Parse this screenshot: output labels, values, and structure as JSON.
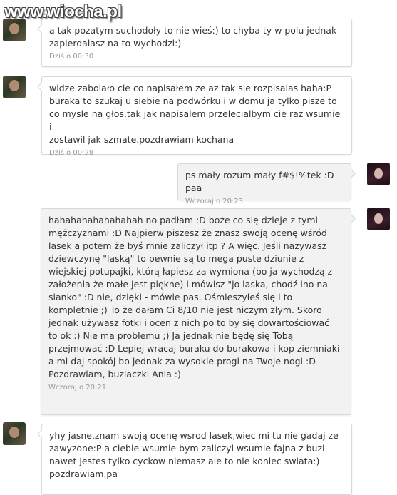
{
  "watermark": "www.wiocha.pl",
  "messages": [
    {
      "side": "left",
      "text": "a tak pozatym suchodoły to nie wieś:) to chyba ty w polu jednak\nzapierdalasz na to wychodzi:)",
      "time": "Dziś o 00:30"
    },
    {
      "side": "left",
      "text": "widze zabolało cie co napisałem ze az tak sie rozpisalas haha:P\nburaka to szukaj u siebie na podwórku i w domu ja tylko pisze to\nco mysle na głos,tak jak napisalem przelecialbym cie raz wsumie i\nzostawil jak szmate.pozdrawiam kochana",
      "time": "Dziś o 00:28"
    },
    {
      "side": "right",
      "text": "ps mały rozum mały f#$!%tek :D paa",
      "time": "Wczoraj o 20:23"
    },
    {
      "side": "right",
      "text": "hahahahahahahahah no padłam :D boże co się dzieje z tymi\nmężczyznami :D Najpierw piszesz że znasz swoją ocenę wśród\nlasek a potem że byś mnie zaliczył itp ? A więc. Jeśli nazywasz\ndziewczynę \"laską\" to pewnie są to mega puste dziunie z\nwiejskiej potupajki, którą łapiesz za wymiona (bo ja wychodzą z\nzałożenia że małe jest piękne) i mówisz \"jo laska, chodź ino na\nsianko\" :D nie, dzięki - mówie pas. Ośmieszyłeś się i to\nkompletnie ;) To że dałam Ci 8/10 nie jest niczym złym. Skoro\njednak używasz fotki i ocen z nich po to by się dowartościować\nto ok :) Nie ma problemu ;) Ja jednak nie będę się Tobą\nprzejmować :D Lepiej wracaj buraku do burakowa i kop ziemniaki\na mi daj spokój bo jednak za wysokie progi na Twoje nogi :D\nPozdrawiam, buziaczki Ania :)",
      "time": "Wczoraj o 20:21"
    },
    {
      "side": "left",
      "text": "yhy jasne,znam swoją ocenę wsrod lasek,wiec mi tu nie gadaj ze\nzawyzone:P a ciebie wsumie bym zaliczyl wsumie fajna z buzi\nnawet jestes tylko cyckow niemasz ale to nie koniec swiata:)\npozdrawiam.pa",
      "time": ""
    }
  ]
}
